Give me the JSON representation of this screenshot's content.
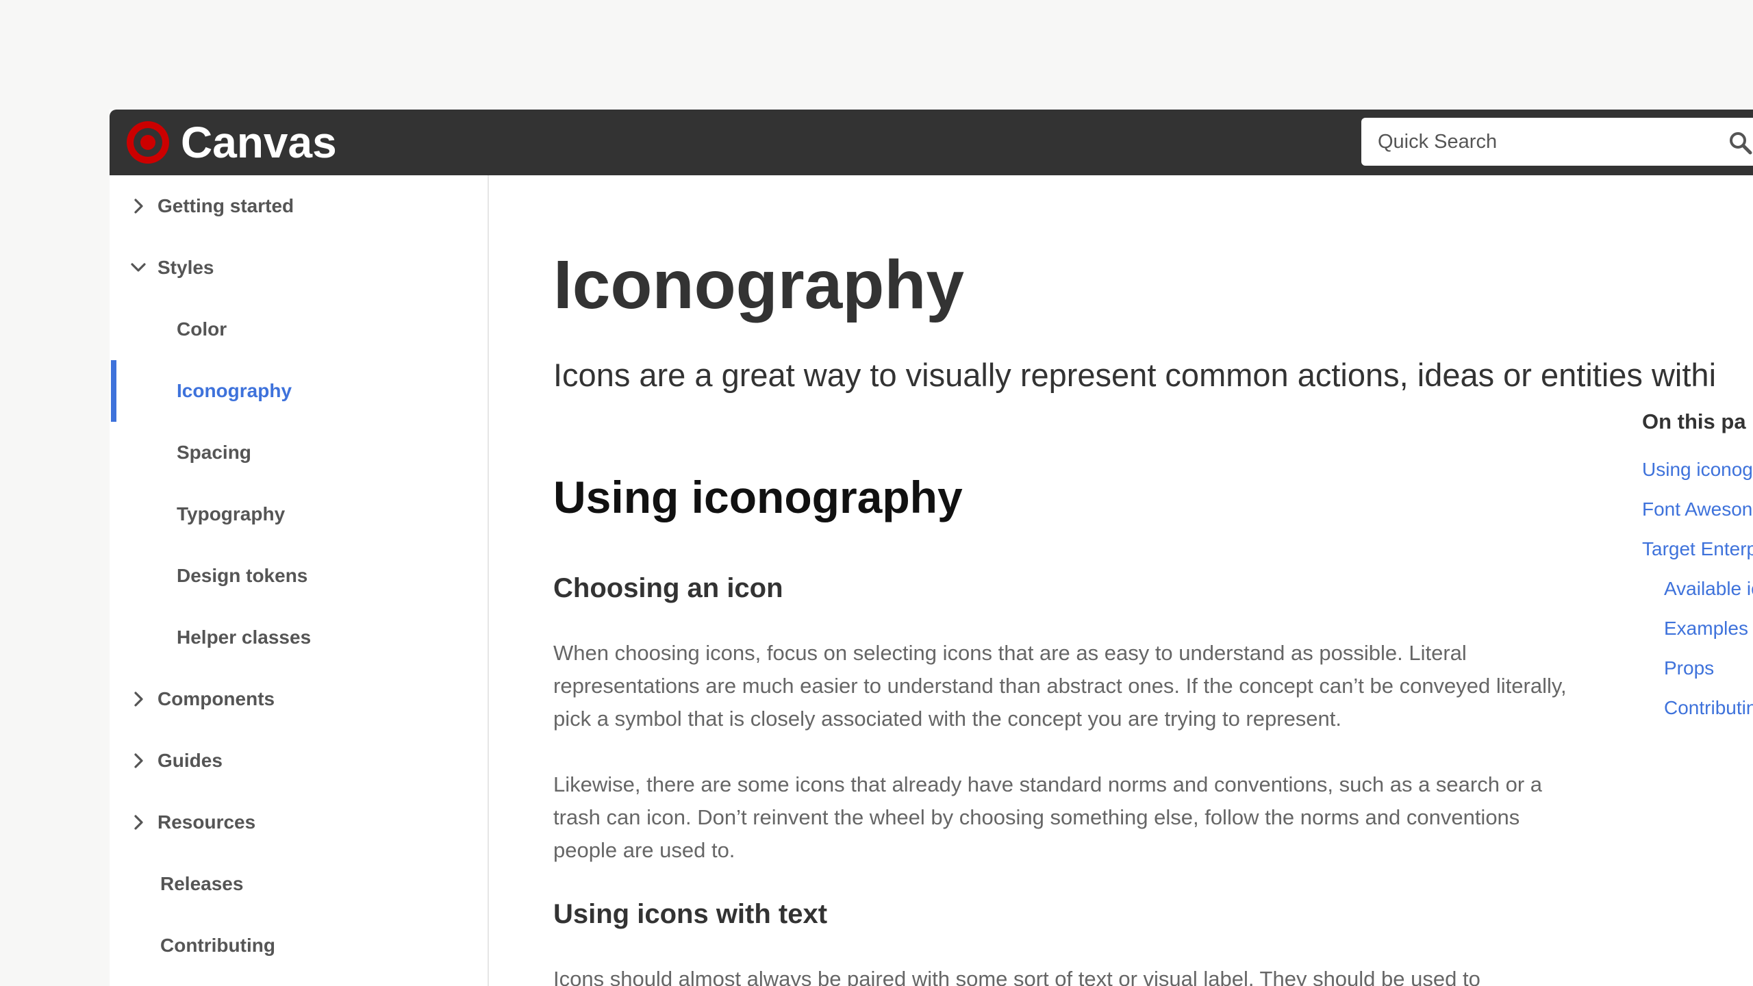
{
  "header": {
    "brand": "Canvas",
    "logo_icon": "target-bullseye-icon",
    "brand_color": "#cc0000",
    "search_placeholder": "Quick Search",
    "search_icon": "search-icon"
  },
  "sidebar": {
    "items": [
      {
        "label": "Getting started",
        "icon": "chevron-right-icon"
      },
      {
        "label": "Styles",
        "icon": "chevron-down-icon"
      },
      {
        "label": "Color"
      },
      {
        "label": "Iconography",
        "active": true
      },
      {
        "label": "Spacing"
      },
      {
        "label": "Typography"
      },
      {
        "label": "Design tokens"
      },
      {
        "label": "Helper classes"
      },
      {
        "label": "Components",
        "icon": "chevron-right-icon"
      },
      {
        "label": "Guides",
        "icon": "chevron-right-icon"
      },
      {
        "label": "Resources",
        "icon": "chevron-right-icon"
      },
      {
        "label": "Releases"
      },
      {
        "label": "Contributing"
      }
    ],
    "active_color": "#3e72db"
  },
  "main": {
    "title": "Iconography",
    "lead": "Icons are a great way to visually represent common actions, ideas or entities withi",
    "section_title": "Using iconography",
    "sub1": "Choosing an icon",
    "para1": "When choosing icons, focus on selecting icons that are as easy to understand as possible. Literal representations are much easier to understand than abstract ones. If the concept can’t be conveyed literally, pick a symbol that is closely associated with the concept you are trying to represent.",
    "para2": "Likewise, there are some icons that already have standard norms and conventions, such as a search or a trash can icon. Don’t reinvent the wheel by choosing something else, follow the norms and conventions people are used to.",
    "sub2": "Using icons with text",
    "para3": "Icons should almost always be paired with some sort of text or visual label. They should be used to"
  },
  "toc": {
    "title": "On this pa",
    "links": [
      "Using iconog",
      "Font Aweson",
      "Target Enterp",
      "Available ic",
      "Examples",
      "Props",
      "Contributin"
    ]
  }
}
